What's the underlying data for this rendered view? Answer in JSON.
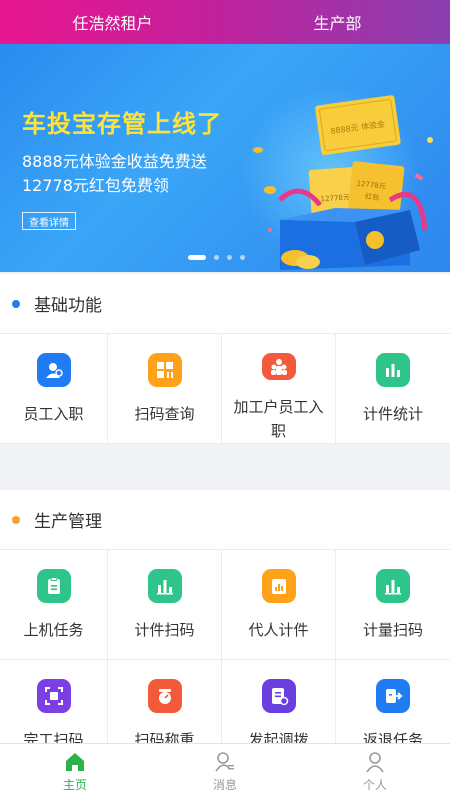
{
  "header": {
    "left_title": "任浩然租户",
    "right_title": "生产部",
    "gradient": [
      "#e8168f",
      "#8a3fb0"
    ]
  },
  "banner": {
    "title": "车投宝存管上线了",
    "line1": "8888元体验金收益免费送",
    "line2": "12778元红包免费领",
    "button": "查看详情",
    "ticket_a": "8888元 体验金",
    "ticket_b": "12778元",
    "ticket_c": "红包",
    "slides": 4,
    "active_slide": 0
  },
  "sections": [
    {
      "title": "基础功能",
      "bullet_color": "#1e7ff0",
      "items": [
        {
          "label": "员工入职",
          "icon": "employee-onboard-icon",
          "color": "#1f7cf2"
        },
        {
          "label": "扫码查询",
          "icon": "scan-query-icon",
          "color": "#ffa21a"
        },
        {
          "label": "加工户员工入职",
          "icon": "processor-onboard-icon",
          "color": "#f25a3a"
        },
        {
          "label": "计件统计",
          "icon": "piece-stats-icon",
          "color": "#2fc58a"
        }
      ]
    },
    {
      "title": "生产管理",
      "bullet_color": "#f5a623",
      "items": [
        {
          "label": "上机任务",
          "icon": "machine-task-icon",
          "color": "#2fc58a"
        },
        {
          "label": "计件扫码",
          "icon": "piece-scan-icon",
          "color": "#2fc58a"
        },
        {
          "label": "代人计件",
          "icon": "proxy-piece-icon",
          "color": "#ffa21a"
        },
        {
          "label": "计量扫码",
          "icon": "measure-scan-icon",
          "color": "#2fc58a"
        },
        {
          "label": "完工扫码",
          "icon": "complete-scan-icon",
          "color": "#7b3fe4"
        },
        {
          "label": "扫码称重",
          "icon": "scan-weigh-icon",
          "color": "#f25a3a"
        },
        {
          "label": "发起调拨",
          "icon": "transfer-icon",
          "color": "#6a3fe0"
        },
        {
          "label": "返退任务",
          "icon": "return-task-icon",
          "color": "#1f7cf2"
        }
      ]
    }
  ],
  "tabbar": {
    "tabs": [
      {
        "label": "主页",
        "icon": "home-icon",
        "active": true
      },
      {
        "label": "消息",
        "icon": "message-icon",
        "active": false
      },
      {
        "label": "个人",
        "icon": "person-icon",
        "active": false
      }
    ],
    "active_color": "#2bb34a"
  }
}
